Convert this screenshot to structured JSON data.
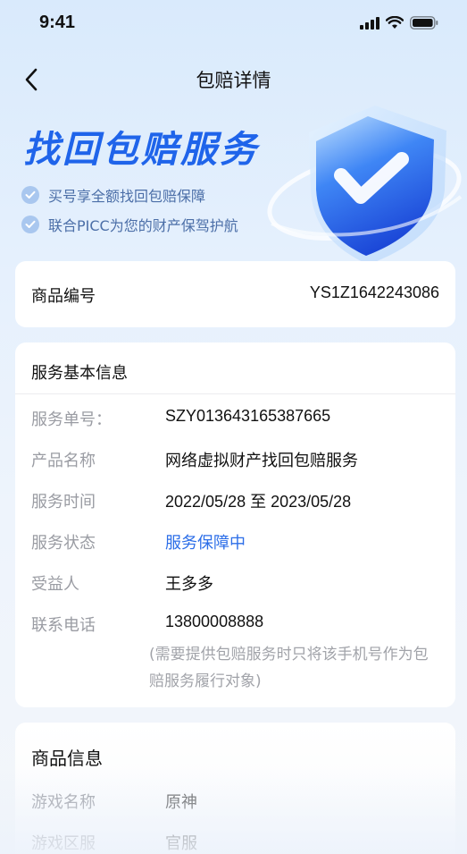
{
  "status_bar": {
    "time": "9:41"
  },
  "nav": {
    "title": "包赔详情"
  },
  "hero": {
    "title": "找回包赔服务",
    "bullets": [
      "买号享全额找回包赔保障",
      "联合PICC为您的财产保驾护航"
    ]
  },
  "product_no": {
    "label": "商品编号",
    "value": "YS1Z1642243086"
  },
  "service_info": {
    "title": "服务基本信息",
    "rows": [
      {
        "label": "服务单号：",
        "value": "SZY013643165387665"
      },
      {
        "label": "产品名称",
        "value": "网络虚拟财产找回包赔服务"
      },
      {
        "label": "服务时间",
        "value": "2022/05/28 至 2023/05/28"
      },
      {
        "label": "服务状态",
        "value": "服务保障中"
      },
      {
        "label": "受益人",
        "value": "王多多"
      },
      {
        "label": "联系电话",
        "value": "13800008888"
      }
    ],
    "note": "(需要提供包赔服务时只将该手机号作为包赔服务履行对象)"
  },
  "goods_info": {
    "title": "商品信息",
    "rows": [
      {
        "label": "游戏名称",
        "value": "原神"
      },
      {
        "label": "游戏区服",
        "value": "官服"
      }
    ]
  },
  "colors": {
    "accent": "#2c6ee8",
    "hero_title": "#1f64ea"
  }
}
